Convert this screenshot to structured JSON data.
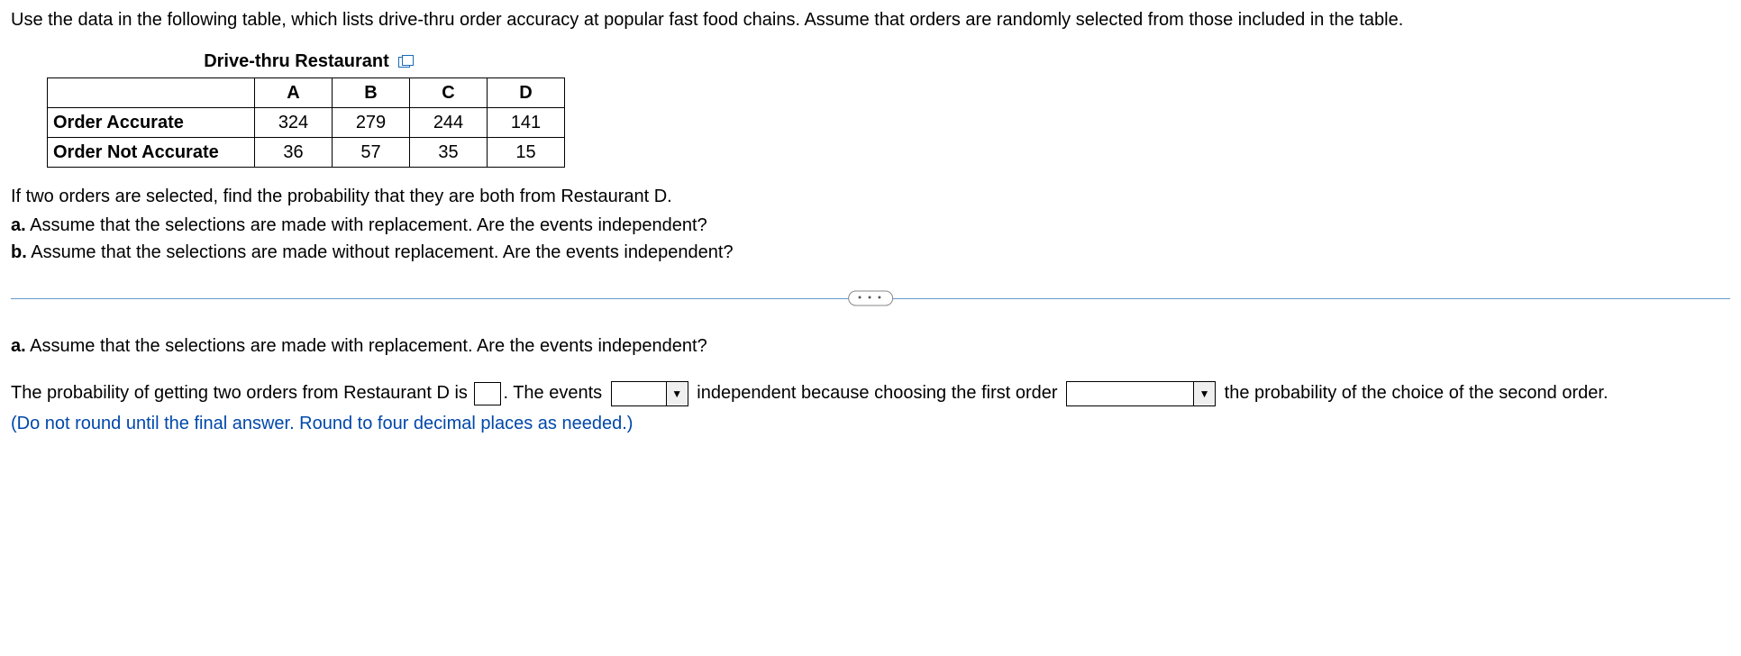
{
  "intro": "Use the data in the following table, which lists drive-thru order accuracy at popular fast food chains. Assume that orders are randomly selected from those included in the table.",
  "table": {
    "title": "Drive-thru Restaurant",
    "columns": [
      "A",
      "B",
      "C",
      "D"
    ],
    "rows": [
      {
        "label": "Order Accurate",
        "values": [
          "324",
          "279",
          "244",
          "141"
        ]
      },
      {
        "label": "Order Not Accurate",
        "values": [
          "36",
          "57",
          "35",
          "15"
        ]
      }
    ]
  },
  "question": {
    "lead": "If two orders are selected, find the probability that they are both from Restaurant D.",
    "a_label": "a.",
    "a_text": " Assume that the selections are made with replacement. Are the events independent?",
    "b_label": "b.",
    "b_text": " Assume that the selections are made without replacement. Are the events independent?"
  },
  "divider": "•  •  •",
  "answer": {
    "part_label": "a.",
    "part_text": " Assume that the selections are made with replacement. Are the events independent?",
    "seg1": "The probability of getting two orders from Restaurant D is ",
    "seg2": ". The events ",
    "seg3": " independent because choosing the first order ",
    "seg4": " the probability of the choice of the second order.",
    "instruction": "(Do not round until the final answer. Round to four decimal places as needed.)",
    "dd_arrow": "▼"
  }
}
